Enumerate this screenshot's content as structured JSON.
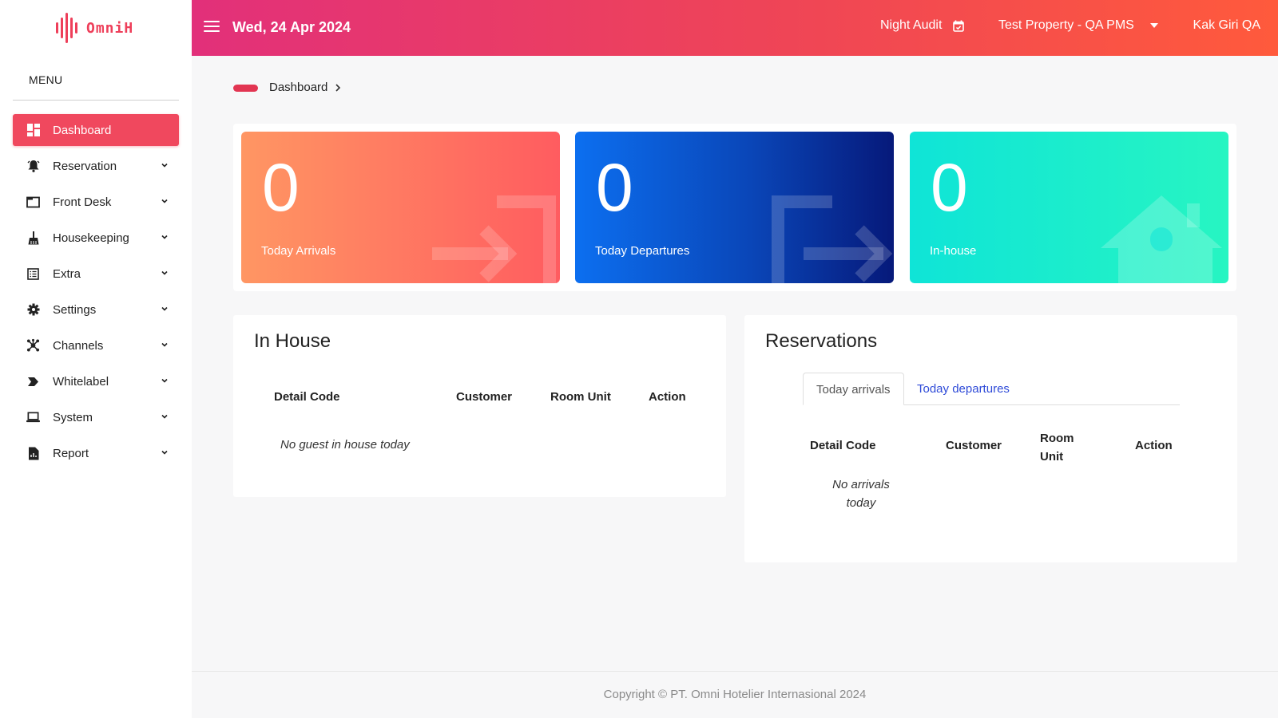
{
  "app": {
    "logo_text": "OmniH",
    "brand_color": "#ee3f5a"
  },
  "sidebar": {
    "menu_title": "MENU",
    "items": [
      {
        "label": "Dashboard",
        "icon": "dashboard-icon",
        "active": true
      },
      {
        "label": "Reservation",
        "icon": "bell-icon"
      },
      {
        "label": "Front Desk",
        "icon": "window-icon"
      },
      {
        "label": "Housekeeping",
        "icon": "broom-icon"
      },
      {
        "label": "Extra",
        "icon": "list-icon"
      },
      {
        "label": "Settings",
        "icon": "gear-icon"
      },
      {
        "label": "Channels",
        "icon": "network-icon"
      },
      {
        "label": "Whitelabel",
        "icon": "tag-icon"
      },
      {
        "label": "System",
        "icon": "laptop-icon"
      },
      {
        "label": "Report",
        "icon": "report-icon"
      }
    ]
  },
  "header": {
    "date": "Wed, 24 Apr 2024",
    "night_audit": "Night Audit",
    "property": "Test Property - QA PMS",
    "user": "Kak Giri QA"
  },
  "breadcrumb": {
    "current": "Dashboard"
  },
  "stats": [
    {
      "value": "0",
      "label": "Today Arrivals",
      "icon": "arrival-arrow-icon"
    },
    {
      "value": "0",
      "label": "Today Departures",
      "icon": "departure-arrow-icon"
    },
    {
      "value": "0",
      "label": "In-house",
      "icon": "house-icon"
    }
  ],
  "in_house": {
    "title": "In House",
    "columns": [
      "Detail Code",
      "Customer",
      "Room Unit",
      "Action"
    ],
    "empty": "No guest in house today"
  },
  "reservations": {
    "title": "Reservations",
    "tabs": [
      "Today arrivals",
      "Today departures"
    ],
    "active_tab": "Today arrivals",
    "columns": [
      "Detail Code",
      "Customer",
      "Room Unit",
      "Action"
    ],
    "empty": "No arrivals today"
  },
  "footer": {
    "copyright": "Copyright © PT. Omni Hotelier Internasional 2024"
  }
}
